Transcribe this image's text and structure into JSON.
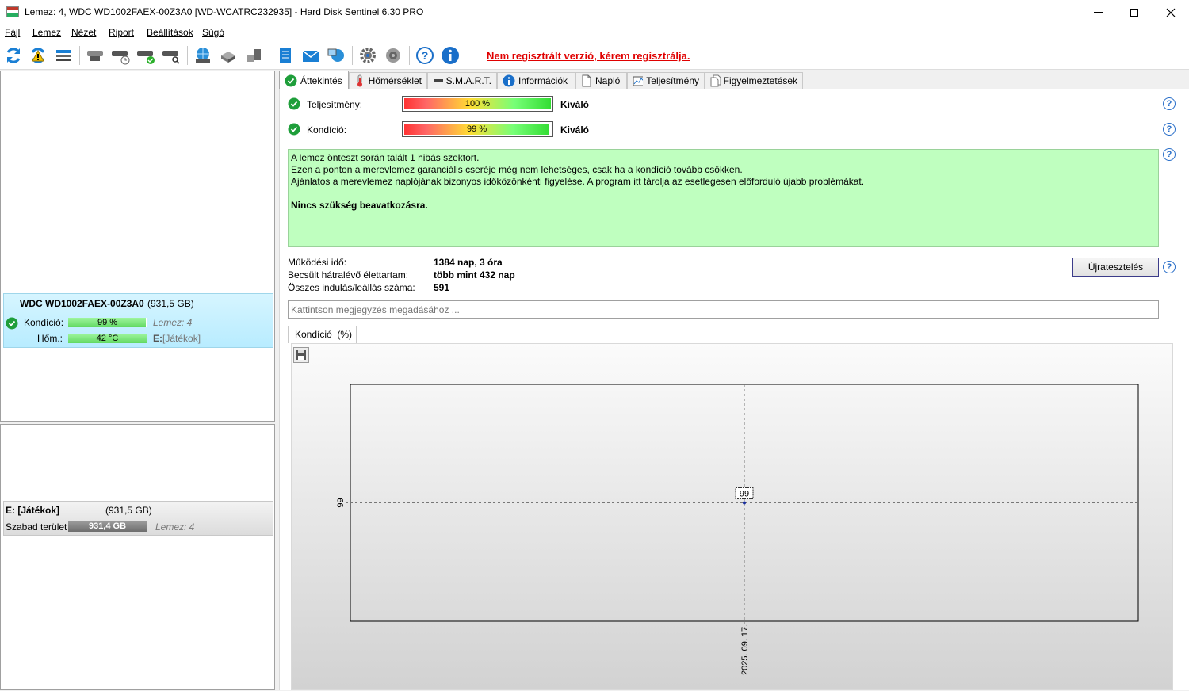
{
  "window": {
    "title": "Lemez: 4, WDC WD1002FAEX-00Z3A0 [WD-WCATRC232935]  -  Hard Disk Sentinel 6.30 PRO"
  },
  "menu": [
    "Fájl",
    "Lemez",
    "Nézet",
    "Riport",
    "Beállítások",
    "Súgó"
  ],
  "toolbar": {
    "unregistered": "Nem regisztrált verzió, kérem regisztrálja."
  },
  "disk": {
    "name": "WDC WD1002FAEX-00Z3A0",
    "size": "(931,5 GB)",
    "health_label": "Kondíció:",
    "health_value": "99 %",
    "health_level": 0.99,
    "temp_label": "Hőm.:",
    "temp_value": "42 °C",
    "temp_level": 1.0,
    "disk_index": "Lemez: 4",
    "volume_letter": "E:",
    "volume_name": "[Játékok]"
  },
  "volume": {
    "name": "E: [Játékok]",
    "size": "(931,5 GB)",
    "free_label": "Szabad terület",
    "free_value": "931,4 GB",
    "free_level": 1.0,
    "disk_index": "Lemez: 4"
  },
  "tabs": [
    "Áttekintés",
    "Hőmérséklet",
    "S.M.A.R.T.",
    "Információk",
    "Napló",
    "Teljesítmény",
    "Figyelmeztetések"
  ],
  "overview": {
    "performance_label": "Teljesítmény:",
    "performance_value": "100 %",
    "performance_level": 1.0,
    "performance_rating": "Kiváló",
    "health_label": "Kondíció:",
    "health_value": "99 %",
    "health_level": 0.99,
    "health_rating": "Kiváló",
    "message_lines": [
      "A lemez önteszt során talált 1 hibás szektort.",
      "Ezen a ponton a merevlemez garanciális cseréje még nem lehetséges, csak ha a kondíció tovább csökken.",
      "Ajánlatos a merevlemez naplójának bizonyos időközönkénti figyelése. A program itt tárolja az esetlegesen előforduló újabb problémákat."
    ],
    "message_bold": "Nincs szükség beavatkozásra.",
    "uptime_label": "Működési idő:",
    "uptime_value": "1384 nap, 3 óra",
    "remaining_label": "Becsült hátralévő élettartam:",
    "remaining_value": "több mint 432 nap",
    "starts_label": "Összes indulás/leállás száma:",
    "starts_value": "591",
    "reset_button": "Újratesztelés",
    "note_placeholder": "Kattintson megjegyzés megadásához ...",
    "chart_tab": "Kondíció  (%)",
    "help_glyph": "?"
  },
  "chart_data": {
    "type": "line",
    "title": "",
    "xlabel": "",
    "ylabel": "",
    "x": [
      "2025. 09. 17."
    ],
    "series": [
      {
        "values": [
          99
        ]
      }
    ],
    "ytick_labels": [
      "99"
    ],
    "data_labels": [
      "99"
    ],
    "grid": true
  }
}
